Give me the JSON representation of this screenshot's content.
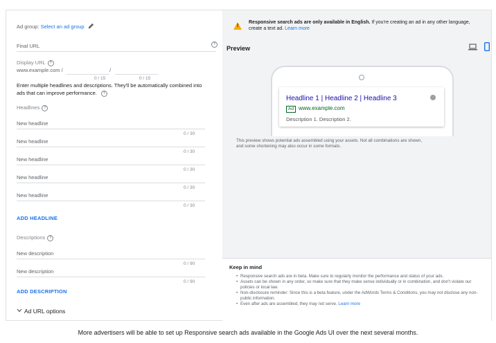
{
  "form": {
    "ad_group_label": "Ad group:",
    "ad_group_link": "Select an ad group",
    "final_url_placeholder": "Final URL",
    "display_url_label": "Display URL",
    "display_url_base": "www.example.com /",
    "path_separator": "/",
    "path1_counter": "0 / 15",
    "path2_counter": "0 / 15",
    "intro_text_line1": "Enter multiple headlines and descriptions. They'll be automatically combined into",
    "intro_text_line2": "ads that can improve performance.",
    "headlines_label": "Headlines",
    "headlines": [
      {
        "placeholder": "New headline",
        "counter": "0 / 30"
      },
      {
        "placeholder": "New headline",
        "counter": "0 / 30"
      },
      {
        "placeholder": "New headline",
        "counter": "0 / 30"
      },
      {
        "placeholder": "New headline",
        "counter": "0 / 30"
      },
      {
        "placeholder": "New headline",
        "counter": "0 / 30"
      }
    ],
    "add_headline": "ADD HEADLINE",
    "descriptions_label": "Descriptions",
    "descriptions": [
      {
        "placeholder": "New description",
        "counter": "0 / 90"
      },
      {
        "placeholder": "New description",
        "counter": "0 / 90"
      }
    ],
    "add_description": "ADD DESCRIPTION",
    "ad_url_options": "Ad URL options"
  },
  "preview": {
    "warning_bold": "Responsive search ads are only available in English.",
    "warning_rest": " If you're creating an ad in any other language,",
    "warning_line2": "create a text ad.",
    "warning_link": "Learn more",
    "title": "Preview",
    "ad_headline": "Headline 1 | Headline 2 | Headline 3",
    "ad_badge": "Ad",
    "ad_url": "www.example.com",
    "ad_description": "Description 1. Description 2.",
    "note_line1": "This preview shows potential ads assembled using your assets. Not all combinations are shown,",
    "note_line2": "and some shortening may also occur in some formats.",
    "keep_in_mind_title": "Keep in mind",
    "bullets": [
      "Responsive search ads are in beta. Make sure to regularly monitor the performance and status of your ads.",
      "Assets can be shown in any order, so make sure that they make sense individually or in combination, and don't violate our policies or local law.",
      "Non-disclosure reminder: Since this is a beta feature, under the AdWords Terms & Conditions, you may not disclose any non-public information.",
      "Even after ads are assembled, they may not serve."
    ],
    "bullet_link": "Learn more"
  },
  "caption": "More advertisers will be able to set up Responsive search ads available in the Google Ads UI over the next several months.",
  "colors": {
    "accent": "#1a73e8",
    "warning": "#f9ab00",
    "ad_title": "#1a0dab",
    "ad_url": "#006621"
  },
  "icons": [
    "pencil-icon",
    "help-icon",
    "warning-icon",
    "desktop-icon",
    "mobile-icon",
    "info-icon",
    "chevron-down-icon"
  ]
}
